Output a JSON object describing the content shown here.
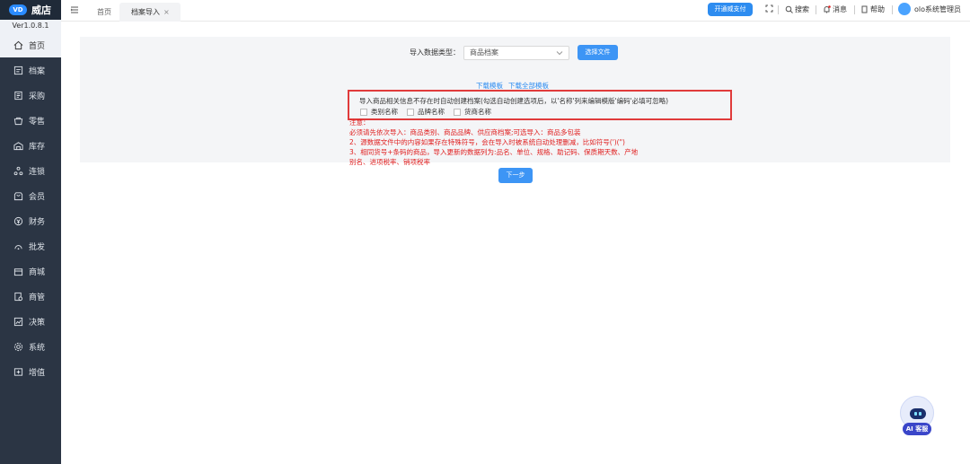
{
  "app": {
    "logo_mark": "VD",
    "name": "威店",
    "version": "Ver1.0.8.1"
  },
  "sidebar": {
    "items": [
      {
        "label": "首页",
        "icon": "home-icon"
      },
      {
        "label": "档案",
        "icon": "archive-icon"
      },
      {
        "label": "采购",
        "icon": "purchase-icon"
      },
      {
        "label": "零售",
        "icon": "retail-icon"
      },
      {
        "label": "库存",
        "icon": "warehouse-icon"
      },
      {
        "label": "连锁",
        "icon": "chain-icon"
      },
      {
        "label": "会员",
        "icon": "member-icon"
      },
      {
        "label": "财务",
        "icon": "finance-icon"
      },
      {
        "label": "批发",
        "icon": "wholesale-icon"
      },
      {
        "label": "商城",
        "icon": "mall-icon"
      },
      {
        "label": "商管",
        "icon": "merchant-icon"
      },
      {
        "label": "决策",
        "icon": "decision-icon"
      },
      {
        "label": "系统",
        "icon": "system-icon"
      },
      {
        "label": "增值",
        "icon": "addon-icon"
      }
    ]
  },
  "header": {
    "tabs": {
      "home": "首页",
      "current": "档案导入",
      "close": "×"
    },
    "open_pay": "开通威支付",
    "search": "搜索",
    "messages": "消息",
    "help": "帮助",
    "user": "olo系统管理员"
  },
  "import": {
    "type_label": "导入数据类型：",
    "type_value": "商品档案",
    "select_file": "选择文件",
    "download_template": "下载模板",
    "download_all": "下载全部模板",
    "auto_create_notice": "导入商品相关信息不存在时自动创建档案(勾选自动创建选项后，以'名称'列来编辑模版'编码'必填可忽略)",
    "checkboxes": [
      "类别名称",
      "品牌名称",
      "货商名称"
    ],
    "notes": [
      "注意：",
      "必须请先依次导入：商品类别、商品品牌、供应商档案;可选导入：商品多包装",
      "2、源数据文件中的内容如果存在特殊符号，会在导入时被系统自动处理删减，比如符号(')(\")",
      "3、相同货号+条码的商品，导入更新的数据列为:品名、单位、规格、助记码、保质期天数、产地",
      "别名、进项税率、销项税率"
    ],
    "next": "下一步"
  },
  "ai": {
    "label": "AI 客服"
  },
  "colors": {
    "sidebar": "#2b3544",
    "primary": "#2d8cf0",
    "warning": "#e02020"
  }
}
